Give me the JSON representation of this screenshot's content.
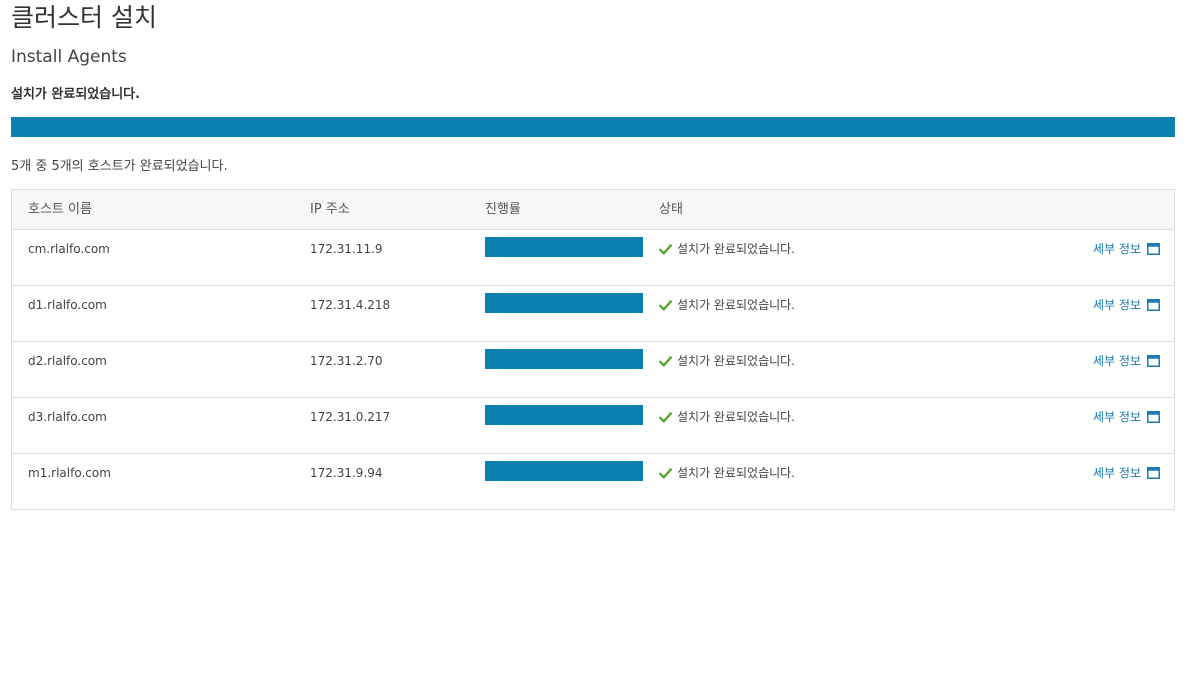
{
  "page": {
    "title": "클러스터 설치",
    "subtitle": "Install Agents",
    "status_heading": "설치가 완료되었습니다.",
    "overall_progress": 100,
    "summary": "5개 중 5개의 호스트가 완료되었습니다."
  },
  "table": {
    "columns": {
      "host": "호스트 이름",
      "ip": "IP 주소",
      "progress": "진행률",
      "status": "상태"
    },
    "rows": [
      {
        "host": "cm.rlalfo.com",
        "ip": "172.31.11.9",
        "progress": 100,
        "status": "설치가 완료되었습니다.",
        "details": "세부 정보"
      },
      {
        "host": "d1.rlalfo.com",
        "ip": "172.31.4.218",
        "progress": 100,
        "status": "설치가 완료되었습니다.",
        "details": "세부 정보"
      },
      {
        "host": "d2.rlalfo.com",
        "ip": "172.31.2.70",
        "progress": 100,
        "status": "설치가 완료되었습니다.",
        "details": "세부 정보"
      },
      {
        "host": "d3.rlalfo.com",
        "ip": "172.31.0.217",
        "progress": 100,
        "status": "설치가 완료되었습니다.",
        "details": "세부 정보"
      },
      {
        "host": "m1.rlalfo.com",
        "ip": "172.31.9.94",
        "progress": 100,
        "status": "설치가 완료되었습니다.",
        "details": "세부 정보"
      }
    ]
  },
  "colors": {
    "progress": "#0b80b0",
    "success": "#5aa832",
    "link": "#1a7ab8"
  },
  "icons": {
    "status": "check-icon",
    "details": "window-icon"
  }
}
